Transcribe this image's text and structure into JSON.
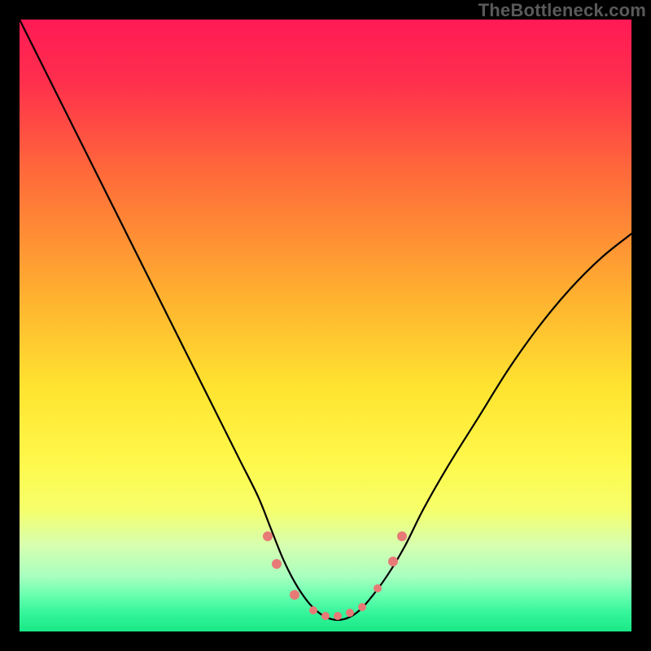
{
  "watermark": {
    "text": "TheBottleneck.com"
  },
  "chart_data": {
    "type": "line",
    "title": "",
    "xlabel": "",
    "ylabel": "",
    "xlim": [
      0,
      100
    ],
    "ylim": [
      0,
      100
    ],
    "grid": false,
    "legend": false,
    "background_gradient": {
      "stops": [
        {
          "pct": 0,
          "color": "#ff1a55"
        },
        {
          "pct": 10,
          "color": "#ff2e4d"
        },
        {
          "pct": 25,
          "color": "#ff6a3a"
        },
        {
          "pct": 45,
          "color": "#ffb030"
        },
        {
          "pct": 60,
          "color": "#ffe330"
        },
        {
          "pct": 72,
          "color": "#fff84a"
        },
        {
          "pct": 80,
          "color": "#f6ff6a"
        },
        {
          "pct": 86,
          "color": "#d6ffb0"
        },
        {
          "pct": 91,
          "color": "#a8ffc0"
        },
        {
          "pct": 94,
          "color": "#6affb0"
        },
        {
          "pct": 97,
          "color": "#34f59a"
        },
        {
          "pct": 100,
          "color": "#1ae887"
        }
      ]
    },
    "series": [
      {
        "name": "bottleneck-curve",
        "color": "#000000",
        "stroke_width": 2.2,
        "x": [
          0,
          3,
          6,
          9,
          12,
          15,
          18,
          21,
          24,
          27,
          30,
          33,
          36,
          39,
          41,
          43,
          45,
          47,
          49,
          51,
          53,
          55,
          57,
          60,
          63,
          66,
          70,
          75,
          80,
          85,
          90,
          95,
          100
        ],
        "y": [
          100,
          94,
          88,
          82,
          76,
          70,
          64,
          58,
          52,
          46,
          40,
          34,
          28,
          22,
          17,
          12,
          8,
          5,
          3,
          2,
          2,
          3,
          5,
          9,
          14,
          20,
          27,
          35,
          43,
          50,
          56,
          61,
          65
        ]
      }
    ],
    "markers": [
      {
        "x": 40.5,
        "y": 15.5,
        "r": 6,
        "color": "#e77a76"
      },
      {
        "x": 42.0,
        "y": 11.0,
        "r": 6,
        "color": "#e77a76"
      },
      {
        "x": 45.0,
        "y": 6.0,
        "r": 6,
        "color": "#e77a76"
      },
      {
        "x": 48.0,
        "y": 3.5,
        "r": 5,
        "color": "#e77a76"
      },
      {
        "x": 50.0,
        "y": 2.5,
        "r": 5,
        "color": "#e77a76"
      },
      {
        "x": 52.0,
        "y": 2.5,
        "r": 5,
        "color": "#e77a76"
      },
      {
        "x": 54.0,
        "y": 3.0,
        "r": 5,
        "color": "#e77a76"
      },
      {
        "x": 56.0,
        "y": 4.0,
        "r": 5,
        "color": "#e77a76"
      },
      {
        "x": 58.5,
        "y": 7.0,
        "r": 5,
        "color": "#e77a76"
      },
      {
        "x": 61.0,
        "y": 11.5,
        "r": 6,
        "color": "#e77a76"
      },
      {
        "x": 62.5,
        "y": 15.5,
        "r": 6,
        "color": "#e77a76"
      }
    ]
  }
}
